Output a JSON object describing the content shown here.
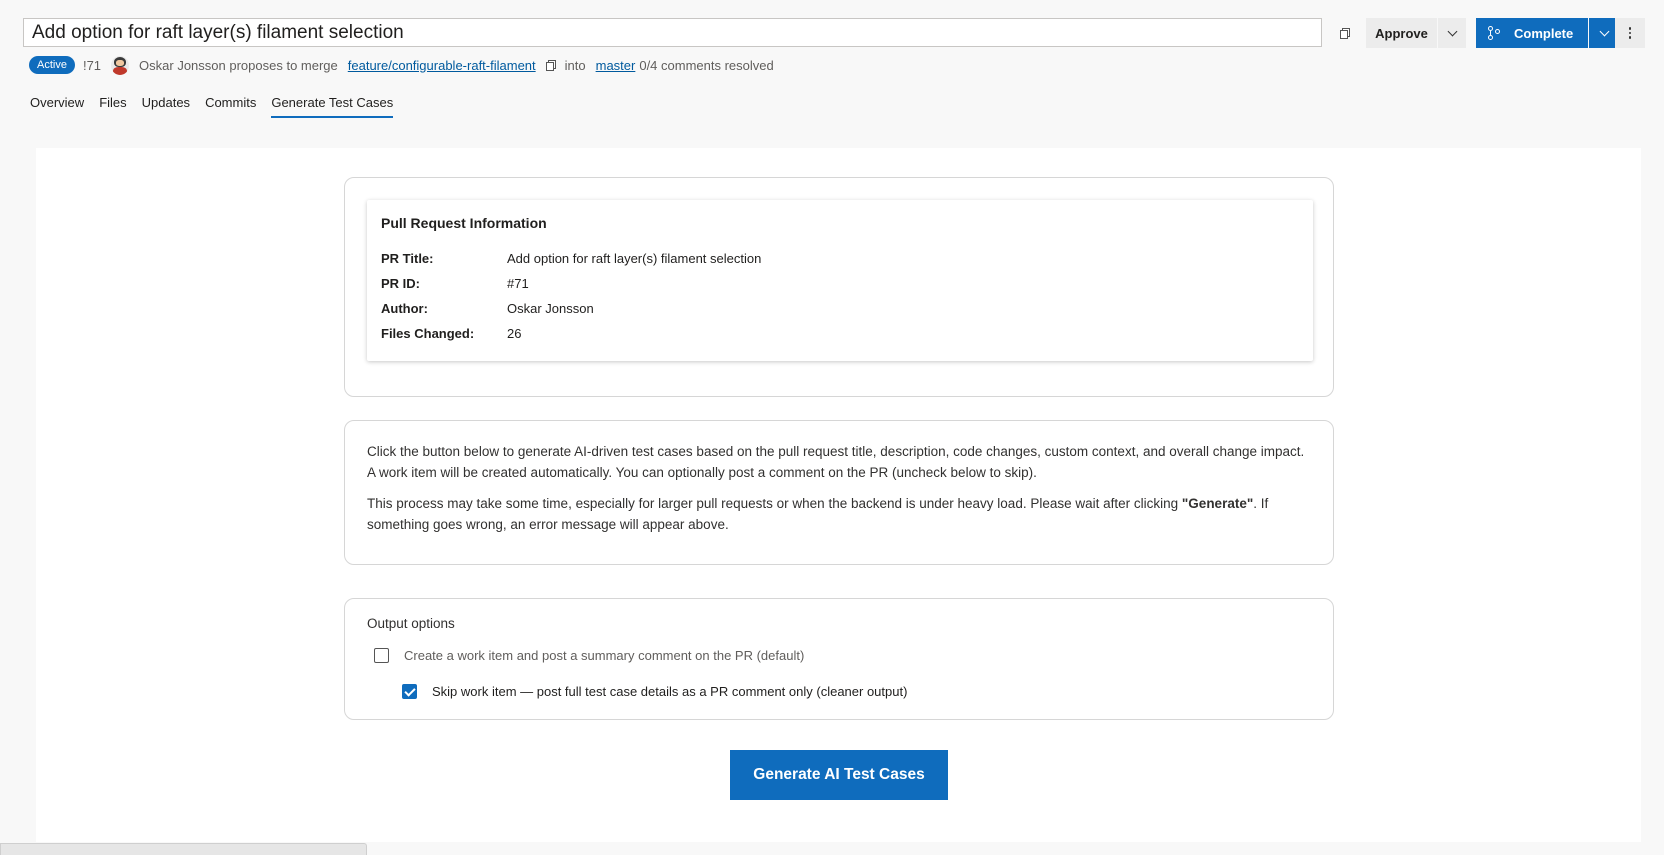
{
  "header": {
    "title": "Add option for raft layer(s) filament selection",
    "approve_label": "Approve",
    "complete_label": "Complete",
    "status_badge": "Active",
    "pr_number": "!71",
    "author_text": "Oskar Jonsson proposes to merge",
    "source_branch": "feature/configurable-raft-filament",
    "into_text": "into",
    "target_branch": "master",
    "comments_resolved": "0/4 comments resolved"
  },
  "tabs": [
    {
      "label": "Overview",
      "active": false
    },
    {
      "label": "Files",
      "active": false
    },
    {
      "label": "Updates",
      "active": false
    },
    {
      "label": "Commits",
      "active": false
    },
    {
      "label": "Generate Test Cases",
      "active": true
    }
  ],
  "pr_info": {
    "title": "Pull Request Information",
    "rows": [
      {
        "label": "PR Title:",
        "value": "Add option for raft layer(s) filament selection"
      },
      {
        "label": "PR ID:",
        "value": "#71"
      },
      {
        "label": "Author:",
        "value": "Oskar Jonsson"
      },
      {
        "label": "Files Changed:",
        "value": "26"
      }
    ]
  },
  "description": {
    "para1": "Click the button below to generate AI-driven test cases based on the pull request title, description, code changes, custom context, and overall change impact. A work item will be created automatically. You can optionally post a comment on the PR (uncheck below to skip).",
    "para2_prefix": "This process may take some time, especially for larger pull requests or when the backend is under heavy load. Please wait after clicking ",
    "para2_bold": "\"Generate\"",
    "para2_suffix": ". If something goes wrong, an error message will appear above."
  },
  "output_options": {
    "title": "Output options",
    "option1_label": "Create a work item and post a summary comment on the PR (default)",
    "option1_checked": false,
    "option2_label": "Skip work item — post full test case details as a PR comment only (cleaner output)",
    "option2_checked": true
  },
  "generate_button_label": "Generate AI Test Cases",
  "colors": {
    "accent": "#0f6cbd",
    "link": "#005a9e",
    "background": "#f8f8f8"
  },
  "icons": [
    "copy-icon",
    "chevron-down-icon",
    "branch-icon",
    "more-icon",
    "avatar",
    "checkbox-icon"
  ]
}
